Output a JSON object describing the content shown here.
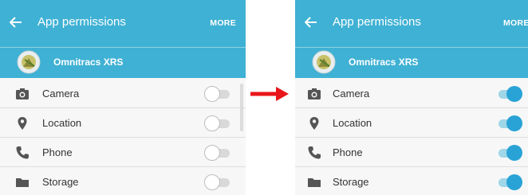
{
  "screens": {
    "before": {
      "title": "App permissions",
      "more_label": "MORE",
      "app_name": "Omnitracs XRS",
      "permissions": [
        {
          "label": "Camera",
          "icon": "camera-icon",
          "enabled": false
        },
        {
          "label": "Location",
          "icon": "location-pin-icon",
          "enabled": false
        },
        {
          "label": "Phone",
          "icon": "phone-icon",
          "enabled": false
        },
        {
          "label": "Storage",
          "icon": "folder-icon",
          "enabled": false
        }
      ]
    },
    "after": {
      "title": "App permissions",
      "more_label": "MORE",
      "app_name": "Omnitracs XRS",
      "permissions": [
        {
          "label": "Camera",
          "icon": "camera-icon",
          "enabled": true
        },
        {
          "label": "Location",
          "icon": "location-pin-icon",
          "enabled": true
        },
        {
          "label": "Phone",
          "icon": "phone-icon",
          "enabled": true
        },
        {
          "label": "Storage",
          "icon": "folder-icon",
          "enabled": true
        }
      ]
    }
  },
  "colors": {
    "app_bar": "#3fb1d4",
    "toggle_on": "#29a3d6",
    "toggle_off_track": "#d9d9d9",
    "transition_arrow": "#e8161b"
  },
  "transition_arrow_icon": "right-arrow-icon"
}
